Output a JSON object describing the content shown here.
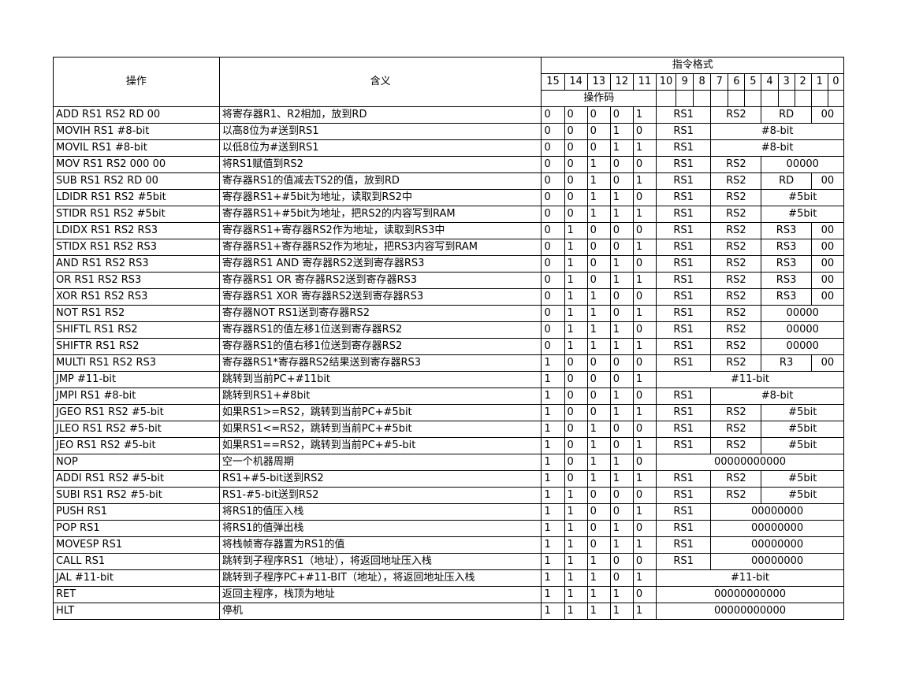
{
  "header": {
    "operation": "操作",
    "meaning": "含义",
    "format": "指令格式",
    "opcode": "操作码",
    "bits": [
      "15",
      "14",
      "13",
      "12",
      "11",
      "10",
      "9",
      "8",
      "7",
      "6",
      "5",
      "4",
      "3",
      "2",
      "1",
      "0"
    ]
  },
  "rows": [
    {
      "op": "ADD RS1 RS2 RD 00",
      "desc": "将寄存器R1、R2相加，放到RD",
      "code": [
        "0",
        "0",
        "0",
        "0",
        "1"
      ],
      "fields": [
        {
          "t": "RS1",
          "s": 3
        },
        {
          "t": "RS2",
          "s": 3
        },
        {
          "t": "RD",
          "s": 3
        },
        {
          "t": "00",
          "s": 2
        }
      ]
    },
    {
      "op": "MOVIH RS1 #8-bit",
      "desc": "以高8位为#送到RS1",
      "code": [
        "0",
        "0",
        "0",
        "1",
        "0"
      ],
      "fields": [
        {
          "t": "RS1",
          "s": 3
        },
        {
          "t": "#8-bit",
          "s": 8
        }
      ]
    },
    {
      "op": "MOVIL RS1 #8-bit",
      "desc": "以低8位为#送到RS1",
      "code": [
        "0",
        "0",
        "0",
        "1",
        "1"
      ],
      "fields": [
        {
          "t": "RS1",
          "s": 3
        },
        {
          "t": "#8-bit",
          "s": 8
        }
      ]
    },
    {
      "op": "MOV RS1 RS2 000 00",
      "desc": "将RS1赋值到RS2",
      "code": [
        "0",
        "0",
        "1",
        "0",
        "0"
      ],
      "fields": [
        {
          "t": "RS1",
          "s": 3
        },
        {
          "t": "RS2",
          "s": 3
        },
        {
          "t": "00000",
          "s": 5
        }
      ]
    },
    {
      "op": "SUB RS1 RS2 RD 00",
      "desc": "寄存器RS1的值减去TS2的值，放到RD",
      "code": [
        "0",
        "0",
        "1",
        "0",
        "1"
      ],
      "fields": [
        {
          "t": "RS1",
          "s": 3
        },
        {
          "t": "RS2",
          "s": 3
        },
        {
          "t": "RD",
          "s": 3
        },
        {
          "t": "00",
          "s": 2
        }
      ]
    },
    {
      "op": "LDIDR RS1 RS2 #5bit",
      "desc": "寄存器RS1+#5bit为地址，读取到RS2中",
      "code": [
        "0",
        "0",
        "1",
        "1",
        "0"
      ],
      "fields": [
        {
          "t": "RS1",
          "s": 3
        },
        {
          "t": "RS2",
          "s": 3
        },
        {
          "t": "#5bit",
          "s": 5
        }
      ]
    },
    {
      "op": "STIDR RS1 RS2 #5bit",
      "desc": "寄存器RS1+#5bit为地址，把RS2的内容写到RAM",
      "code": [
        "0",
        "0",
        "1",
        "1",
        "1"
      ],
      "fields": [
        {
          "t": "RS1",
          "s": 3
        },
        {
          "t": "RS2",
          "s": 3
        },
        {
          "t": "#5bit",
          "s": 5
        }
      ]
    },
    {
      "op": "LDIDX RS1 RS2 RS3",
      "desc": "寄存器RS1+寄存器RS2作为地址，读取到RS3中",
      "code": [
        "0",
        "1",
        "0",
        "0",
        "0"
      ],
      "fields": [
        {
          "t": "RS1",
          "s": 3
        },
        {
          "t": "RS2",
          "s": 3
        },
        {
          "t": "RS3",
          "s": 3
        },
        {
          "t": "00",
          "s": 2
        }
      ]
    },
    {
      "op": "STIDX RS1 RS2 RS3",
      "desc": "寄存器RS1+寄存器RS2作为地址，把RS3内容写到RAM",
      "code": [
        "0",
        "1",
        "0",
        "0",
        "1"
      ],
      "fields": [
        {
          "t": "RS1",
          "s": 3
        },
        {
          "t": "RS2",
          "s": 3
        },
        {
          "t": "RS3",
          "s": 3
        },
        {
          "t": "00",
          "s": 2
        }
      ]
    },
    {
      "op": "AND RS1 RS2 RS3",
      "desc": "寄存器RS1 AND 寄存器RS2送到寄存器RS3",
      "code": [
        "0",
        "1",
        "0",
        "1",
        "0"
      ],
      "fields": [
        {
          "t": "RS1",
          "s": 3
        },
        {
          "t": "RS2",
          "s": 3
        },
        {
          "t": "RS3",
          "s": 3
        },
        {
          "t": "00",
          "s": 2
        }
      ]
    },
    {
      "op": "OR RS1 RS2 RS3",
      "desc": "寄存器RS1 OR 寄存器RS2送到寄存器RS3",
      "code": [
        "0",
        "1",
        "0",
        "1",
        "1"
      ],
      "fields": [
        {
          "t": "RS1",
          "s": 3
        },
        {
          "t": "RS2",
          "s": 3
        },
        {
          "t": "RS3",
          "s": 3
        },
        {
          "t": "00",
          "s": 2
        }
      ]
    },
    {
      "op": "XOR RS1 RS2 RS3",
      "desc": "寄存器RS1 XOR 寄存器RS2送到寄存器RS3",
      "code": [
        "0",
        "1",
        "1",
        "0",
        "0"
      ],
      "fields": [
        {
          "t": "RS1",
          "s": 3
        },
        {
          "t": "RS2",
          "s": 3
        },
        {
          "t": "RS3",
          "s": 3
        },
        {
          "t": "00",
          "s": 2
        }
      ]
    },
    {
      "op": "NOT RS1 RS2",
      "desc": "寄存器NOT RS1送到寄存器RS2",
      "code": [
        "0",
        "1",
        "1",
        "0",
        "1"
      ],
      "fields": [
        {
          "t": "RS1",
          "s": 3
        },
        {
          "t": "RS2",
          "s": 3
        },
        {
          "t": "00000",
          "s": 5
        }
      ]
    },
    {
      "op": "SHIFTL RS1 RS2",
      "desc": "寄存器RS1的值左移1位送到寄存器RS2",
      "code": [
        "0",
        "1",
        "1",
        "1",
        "0"
      ],
      "fields": [
        {
          "t": "RS1",
          "s": 3
        },
        {
          "t": "RS2",
          "s": 3
        },
        {
          "t": "00000",
          "s": 5
        }
      ]
    },
    {
      "op": "SHIFTR RS1 RS2",
      "desc": "寄存器RS1的值右移1位送到寄存器RS2",
      "code": [
        "0",
        "1",
        "1",
        "1",
        "1"
      ],
      "fields": [
        {
          "t": "RS1",
          "s": 3
        },
        {
          "t": "RS2",
          "s": 3
        },
        {
          "t": "00000",
          "s": 5
        }
      ]
    },
    {
      "op": "MULTI RS1 RS2 RS3",
      "desc": "寄存器RS1*寄存器RS2结果送到寄存器RS3",
      "code": [
        "1",
        "0",
        "0",
        "0",
        "0"
      ],
      "fields": [
        {
          "t": "RS1",
          "s": 3
        },
        {
          "t": "RS2",
          "s": 3
        },
        {
          "t": "R3",
          "s": 3
        },
        {
          "t": "00",
          "s": 2
        }
      ]
    },
    {
      "op": "JMP #11-bit",
      "desc": "跳转到当前PC+#11bit",
      "code": [
        "1",
        "0",
        "0",
        "0",
        "1"
      ],
      "fields": [
        {
          "t": "#11-bit",
          "s": 11
        }
      ]
    },
    {
      "op": "JMPI RS1 #8-bit",
      "desc": "跳转到RS1+#8bit",
      "code": [
        "1",
        "0",
        "0",
        "1",
        "0"
      ],
      "fields": [
        {
          "t": "RS1",
          "s": 3
        },
        {
          "t": "#8-bit",
          "s": 8
        }
      ]
    },
    {
      "op": "JGEO RS1 RS2 #5-bit",
      "desc": "如果RS1>=RS2，跳转到当前PC+#5bit",
      "code": [
        "1",
        "0",
        "0",
        "1",
        "1"
      ],
      "fields": [
        {
          "t": "RS1",
          "s": 3
        },
        {
          "t": "RS2",
          "s": 3
        },
        {
          "t": "#5bit",
          "s": 5
        }
      ]
    },
    {
      "op": "JLEO RS1 RS2 #5-bit",
      "desc": "如果RS1<=RS2，跳转到当前PC+#5bit",
      "code": [
        "1",
        "0",
        "1",
        "0",
        "0"
      ],
      "fields": [
        {
          "t": "RS1",
          "s": 3
        },
        {
          "t": "RS2",
          "s": 3
        },
        {
          "t": "#5bit",
          "s": 5
        }
      ]
    },
    {
      "op": "JEO RS1 RS2 #5-bit",
      "desc": "如果RS1==RS2，跳转到当前PC+#5-bit",
      "code": [
        "1",
        "0",
        "1",
        "0",
        "1"
      ],
      "fields": [
        {
          "t": "RS1",
          "s": 3
        },
        {
          "t": "RS2",
          "s": 3
        },
        {
          "t": "#5bit",
          "s": 5
        }
      ]
    },
    {
      "op": "NOP",
      "desc": "空一个机器周期",
      "code": [
        "1",
        "0",
        "1",
        "1",
        "0"
      ],
      "fields": [
        {
          "t": "00000000000",
          "s": 11
        }
      ]
    },
    {
      "op": "ADDI RS1 RS2 #5-bit",
      "desc": "RS1+#5-bit送到RS2",
      "code": [
        "1",
        "0",
        "1",
        "1",
        "1"
      ],
      "fields": [
        {
          "t": "RS1",
          "s": 3
        },
        {
          "t": "RS2",
          "s": 3
        },
        {
          "t": "#5bit",
          "s": 5
        }
      ]
    },
    {
      "op": "SUBI RS1 RS2 #5-bit",
      "desc": "RS1-#5-bit送到RS2",
      "code": [
        "1",
        "1",
        "0",
        "0",
        "0"
      ],
      "fields": [
        {
          "t": "RS1",
          "s": 3
        },
        {
          "t": "RS2",
          "s": 3
        },
        {
          "t": "#5bit",
          "s": 5
        }
      ]
    },
    {
      "op": "PUSH RS1",
      "desc": "将RS1的值压入栈",
      "code": [
        "1",
        "1",
        "0",
        "0",
        "1"
      ],
      "fields": [
        {
          "t": "RS1",
          "s": 3
        },
        {
          "t": "00000000",
          "s": 8
        }
      ]
    },
    {
      "op": "POP RS1",
      "desc": "将RS1的值弹出栈",
      "code": [
        "1",
        "1",
        "0",
        "1",
        "0"
      ],
      "fields": [
        {
          "t": "RS1",
          "s": 3
        },
        {
          "t": "00000000",
          "s": 8
        }
      ]
    },
    {
      "op": "MOVESP RS1",
      "desc": "将栈帧寄存器置为RS1的值",
      "code": [
        "1",
        "1",
        "0",
        "1",
        "1"
      ],
      "fields": [
        {
          "t": "RS1",
          "s": 3
        },
        {
          "t": "00000000",
          "s": 8
        }
      ]
    },
    {
      "op": "CALL RS1",
      "desc": "跳转到子程序RS1（地址），将返回地址压入栈",
      "code": [
        "1",
        "1",
        "1",
        "0",
        "0"
      ],
      "fields": [
        {
          "t": "RS1",
          "s": 3
        },
        {
          "t": "00000000",
          "s": 8
        }
      ]
    },
    {
      "op": "JAL #11-bit",
      "desc": "跳转到子程序PC+#11-BIT（地址），将返回地址压入栈",
      "code": [
        "1",
        "1",
        "1",
        "0",
        "1"
      ],
      "fields": [
        {
          "t": "#11-bit",
          "s": 11
        }
      ]
    },
    {
      "op": "RET",
      "desc": "返回主程序，栈顶为地址",
      "code": [
        "1",
        "1",
        "1",
        "1",
        "0"
      ],
      "fields": [
        {
          "t": "00000000000",
          "s": 11
        }
      ]
    },
    {
      "op": "HLT",
      "desc": "停机",
      "code": [
        "1",
        "1",
        "1",
        "1",
        "1"
      ],
      "fields": [
        {
          "t": "00000000000",
          "s": 11
        }
      ]
    }
  ]
}
